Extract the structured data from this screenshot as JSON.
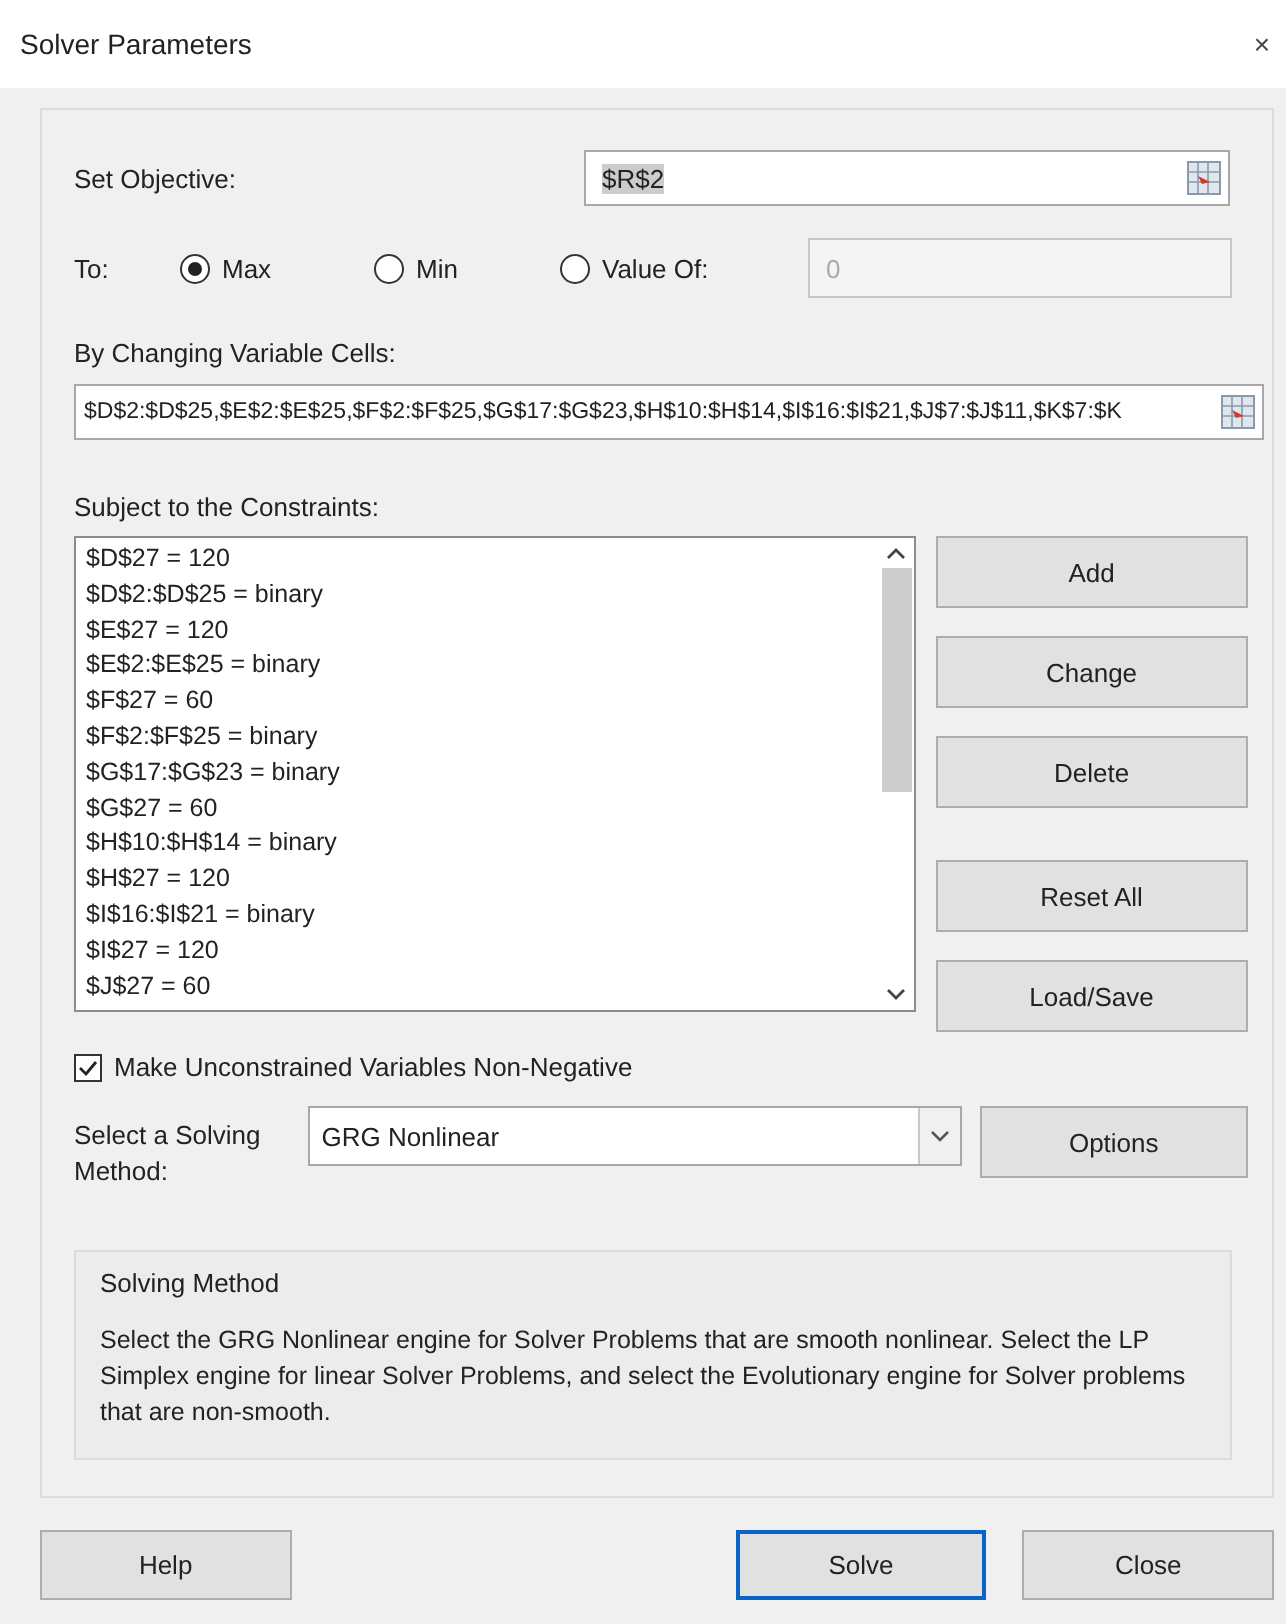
{
  "window": {
    "title": "Solver Parameters",
    "close": "×"
  },
  "objective": {
    "label": "Set Objective:",
    "value": "$R$2"
  },
  "to": {
    "label": "To:",
    "options": [
      {
        "label": "Max",
        "selected": true
      },
      {
        "label": "Min",
        "selected": false
      },
      {
        "label": "Value Of:",
        "selected": false
      }
    ],
    "value_of": {
      "value": "0",
      "disabled": true
    }
  },
  "variables": {
    "label": "By Changing Variable Cells:",
    "value": "$D$2:$D$25,$E$2:$E$25,$F$2:$F$25,$G$17:$G$23,$H$10:$H$14,$I$16:$I$21,$J$7:$J$11,$K$7:$K"
  },
  "constraints": {
    "label": "Subject to the Constraints:",
    "items": [
      "$D$27 = 120",
      "$D$2:$D$25 = binary",
      "$E$27 = 120",
      "$E$2:$E$25 = binary",
      "$F$27 = 60",
      "$F$2:$F$25 = binary",
      "$G$17:$G$23 = binary",
      "$G$27 = 60",
      "$H$10:$H$14 = binary",
      "$H$27 = 120",
      "$I$16:$I$21 = binary",
      "$I$27 = 120",
      "$J$27 = 60"
    ],
    "buttons": [
      "Add",
      "Change",
      "Delete",
      "Reset All",
      "Load/Save"
    ]
  },
  "non_negative": {
    "label": "Make Unconstrained Variables Non-Negative",
    "checked": true
  },
  "method": {
    "label": "Select a Solving Method:",
    "value": "GRG Nonlinear",
    "options_button": "Options"
  },
  "description": {
    "title": "Solving Method",
    "text": "Select the GRG Nonlinear engine for Solver Problems that are smooth nonlinear. Select the LP Simplex engine for linear Solver Problems, and select the Evolutionary engine for Solver problems that are non-smooth."
  },
  "footer": [
    {
      "label": "Help",
      "default": false
    },
    {
      "label": "Solve",
      "default": true
    },
    {
      "label": "Close",
      "default": false
    }
  ]
}
